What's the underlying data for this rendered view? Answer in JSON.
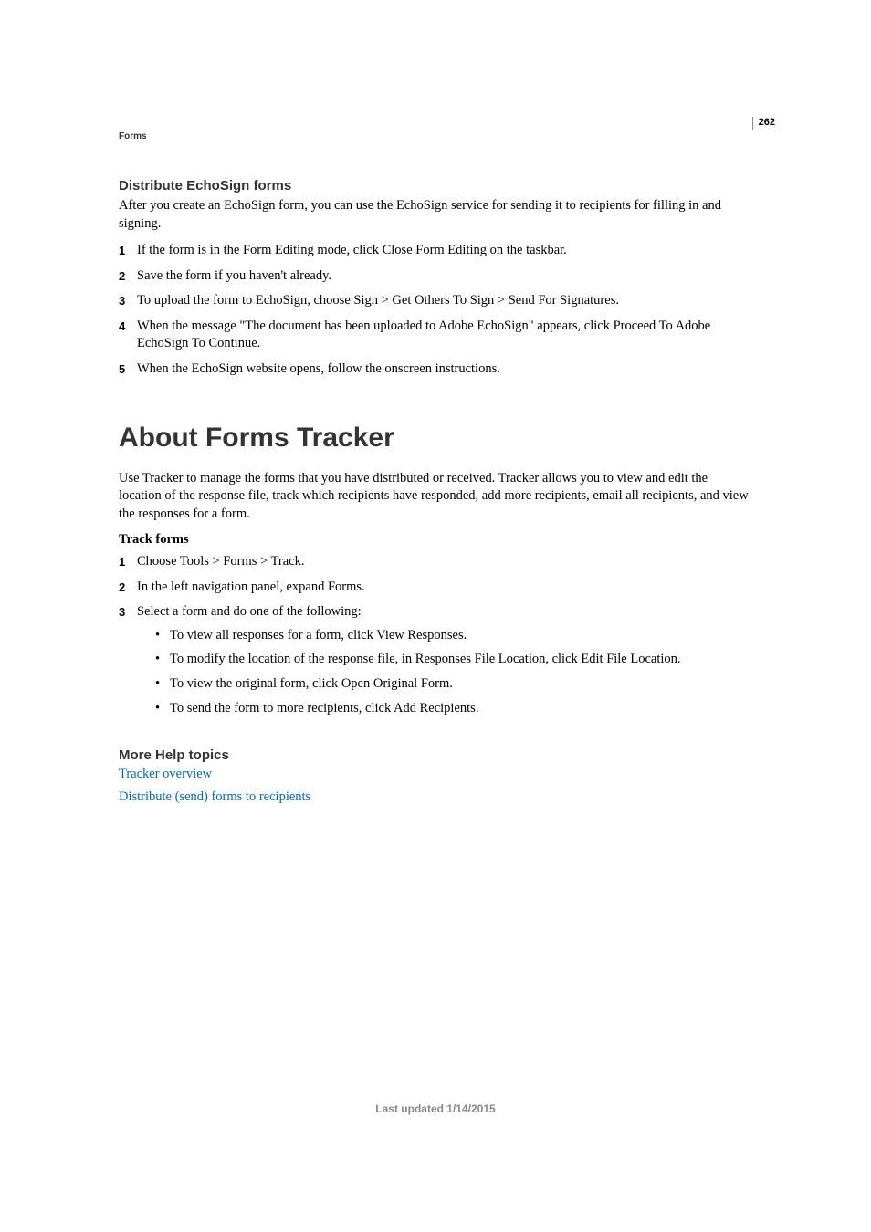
{
  "page_number": "262",
  "section_header": "Forms",
  "subsection1": {
    "heading": "Distribute EchoSign forms",
    "intro": "After you create an EchoSign form, you can use the EchoSign service for sending it to recipients for filling in and signing.",
    "steps": [
      "If the form is in the Form Editing mode, click Close Form Editing on the taskbar.",
      "Save the form if you haven't already.",
      "To upload the form to EchoSign, choose Sign > Get Others To Sign > Send For Signatures.",
      "When the message \"The document has been uploaded to Adobe EchoSign\" appears, click Proceed To Adobe EchoSign To Continue.",
      "When the EchoSign website opens, follow the onscreen instructions."
    ]
  },
  "main_section": {
    "heading": "About Forms Tracker",
    "intro": "Use Tracker to manage the forms that you have distributed or received. Tracker allows you to view and edit the location of the response file, track which recipients have responded, add more recipients, email all recipients, and view the responses for a form.",
    "sub_heading": "Track forms",
    "steps": [
      "Choose Tools > Forms > Track.",
      "In the left navigation panel, expand Forms.",
      "Select a form and do one of the following:"
    ],
    "bullets": [
      "To view all responses for a form, click View Responses.",
      "To modify the location of the response file, in Responses File Location, click Edit File Location.",
      "To view the original form, click Open Original Form.",
      "To send the form to more recipients, click Add Recipients."
    ]
  },
  "more_help": {
    "heading": "More Help topics",
    "links": [
      "Tracker overview",
      "Distribute (send) forms to recipients"
    ]
  },
  "footer": "Last updated 1/14/2015"
}
